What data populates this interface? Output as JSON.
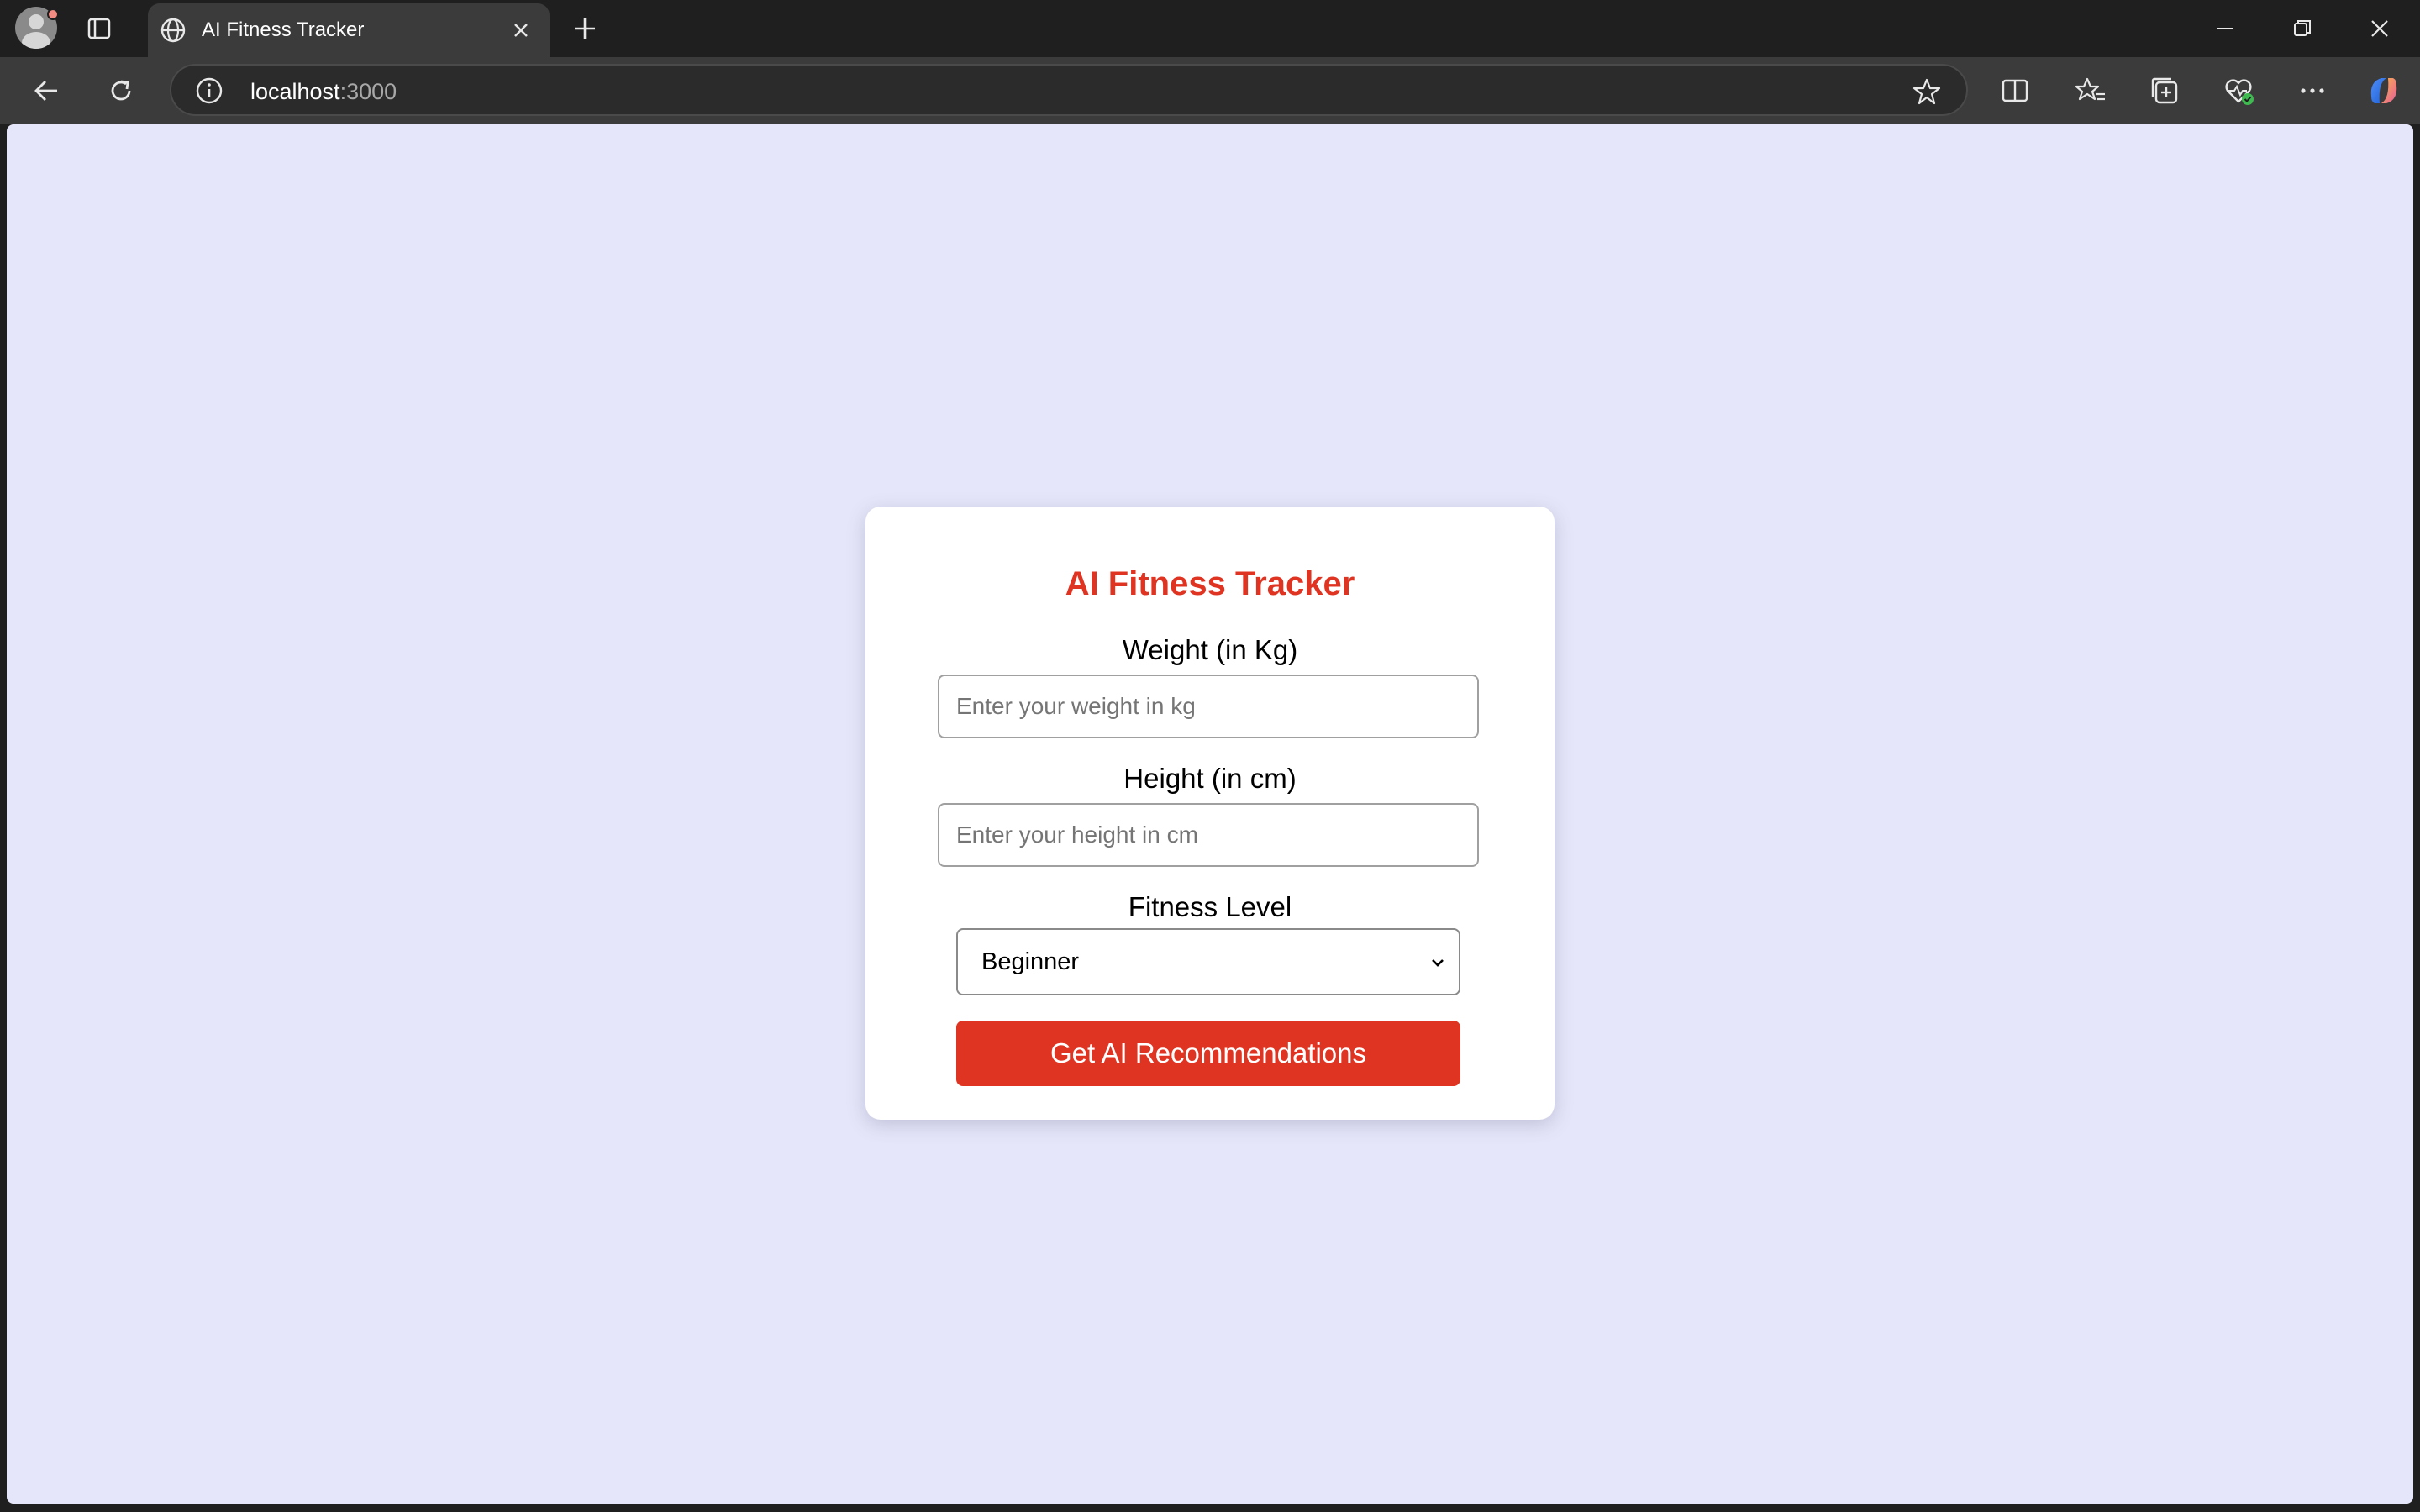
{
  "browser": {
    "tab_title": "AI Fitness Tracker",
    "url_host": "localhost",
    "url_port": ":3000"
  },
  "icons": {
    "profile": "profile-avatar-icon",
    "tab_actions": "tab-actions-icon",
    "globe": "globe-icon",
    "tab_close": "close-icon",
    "new_tab": "plus-icon",
    "back": "back-arrow-icon",
    "refresh": "refresh-icon",
    "site_info": "info-icon",
    "favorite": "star-icon",
    "split_screen": "split-screen-icon",
    "favorites": "favorites-icon",
    "collections": "collections-icon",
    "browser_essentials": "heart-pulse-icon",
    "more": "ellipsis-icon",
    "copilot": "copilot-icon"
  },
  "app": {
    "title": "AI Fitness Tracker",
    "weight_label": "Weight (in Kg)",
    "weight_placeholder": "Enter your weight in kg",
    "height_label": "Height (in cm)",
    "height_placeholder": "Enter your height in cm",
    "fitness_label": "Fitness Level",
    "fitness_selected": "Beginner",
    "submit_label": "Get AI Recommendations"
  },
  "colors": {
    "accent": "#e03422",
    "page_background": "#e6e6fa",
    "card_background": "#ffffff"
  }
}
